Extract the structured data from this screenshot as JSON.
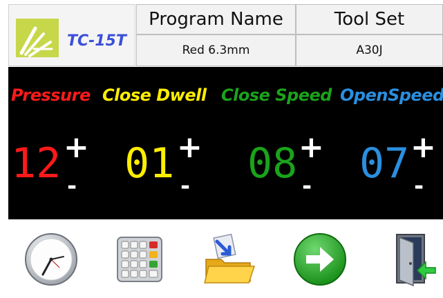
{
  "header": {
    "model": "TC-15T",
    "columns": [
      {
        "label": "Program Name",
        "value": "Red 6.3mm"
      },
      {
        "label": "Tool Set",
        "value": "A30J"
      }
    ]
  },
  "params": [
    {
      "label": "Pressure",
      "value": "12",
      "color": "#ff1a1a"
    },
    {
      "label": "Close Dwell",
      "value": "01",
      "color": "#ffee00"
    },
    {
      "label": "Close Speed",
      "value": "08",
      "color": "#1aa31a"
    },
    {
      "label": "OpenSpeed",
      "value": "07",
      "color": "#2a8fe0"
    }
  ],
  "controls": {
    "plus": "+",
    "minus": "-"
  },
  "toolbar": [
    "clock-icon",
    "keypad-icon",
    "open-folder-icon",
    "next-arrow-icon",
    "exit-door-icon"
  ]
}
